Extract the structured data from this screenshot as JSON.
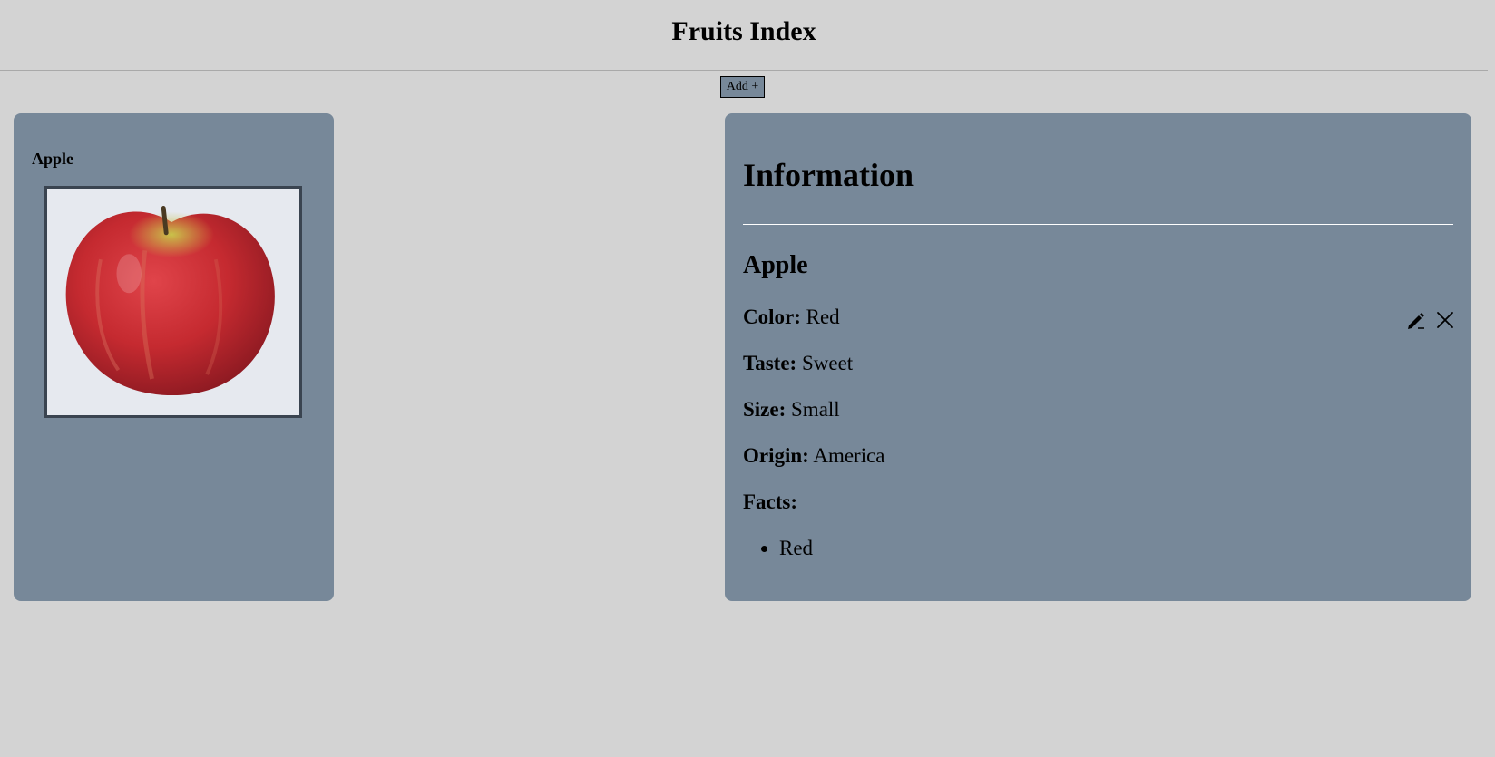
{
  "header": {
    "title": "Fruits Index"
  },
  "toolbar": {
    "add_label": "Add +"
  },
  "card": {
    "name": "Apple",
    "image_icon": "apple-image"
  },
  "info": {
    "title": "Information",
    "fruit_name": "Apple",
    "color_label": "Color:",
    "color_value": "Red",
    "taste_label": "Taste:",
    "taste_value": "Sweet",
    "size_label": "Size:",
    "size_value": "Small",
    "origin_label": "Origin:",
    "origin_value": "America",
    "facts_label": "Facts:",
    "facts": [
      "Red"
    ],
    "edit_icon": "pencil-icon",
    "close_icon": "close-icon"
  },
  "colors": {
    "background": "#d3d3d3",
    "panel": "#778899",
    "divider": "#ffffff"
  }
}
